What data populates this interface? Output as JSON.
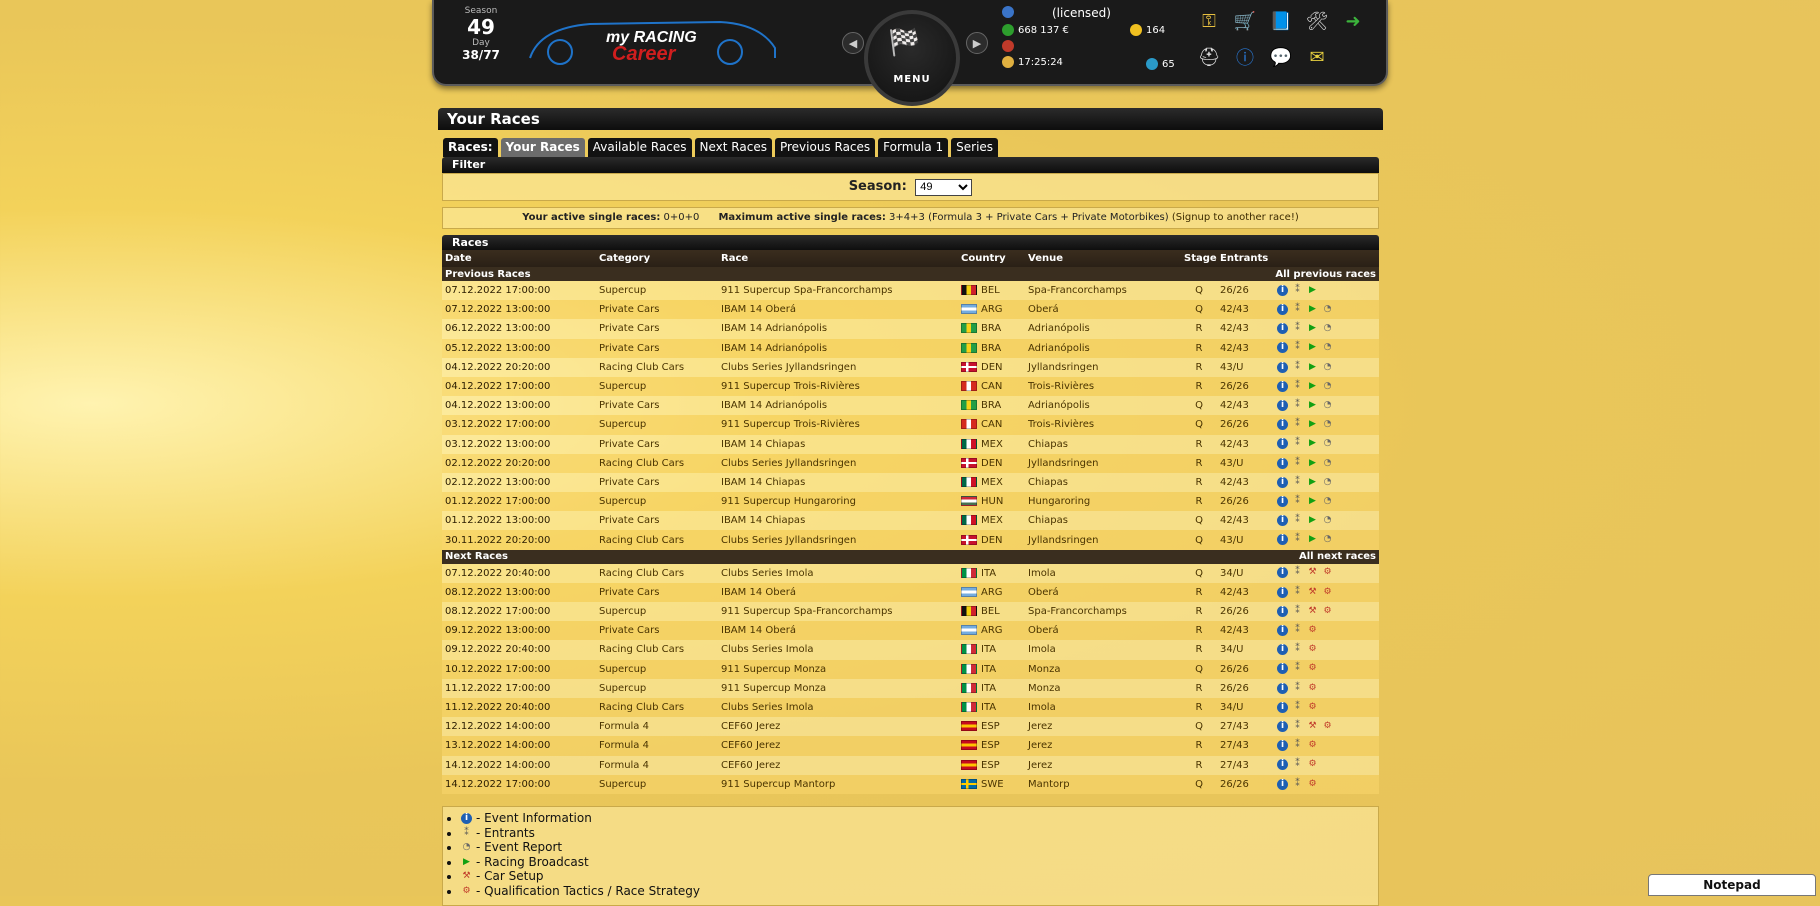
{
  "header": {
    "season_label": "Season",
    "season_value": "49",
    "day_label": "Day",
    "day_value": "38/77",
    "license": "(licensed)",
    "money": "668 137 €",
    "time": "17:25:24",
    "coins": "164",
    "points": "65",
    "menu_label": "MENU",
    "logo_text_top": "my RACING",
    "logo_text_bottom": "Career"
  },
  "page_title": "Your Races",
  "tabs": {
    "lead": "Races:",
    "items": [
      "Your Races",
      "Available Races",
      "Next Races",
      "Previous Races",
      "Formula 1",
      "Series"
    ]
  },
  "filter": {
    "title": "Filter",
    "season_label": "Season:",
    "season_value": "49"
  },
  "active_info": {
    "active_label": "Your active single races:",
    "active_value": "0+0+0",
    "max_label": "Maximum active single races:",
    "max_value": "3+4+3 (Formula 3 + Private Cars + Private Motorbikes)",
    "signup": "(Signup to another race!)"
  },
  "races": {
    "title": "Races",
    "columns": [
      "Date",
      "Category",
      "Race",
      "Country",
      "Venue",
      "Stage",
      "Entrants",
      ""
    ],
    "previous_label": "Previous Races",
    "previous_link": "All previous races",
    "next_label": "Next Races",
    "next_link": "All next races",
    "previous": [
      {
        "date": "07.12.2022 17:00:00",
        "category": "Supercup",
        "race": "911 Supercup Spa-Francorchamps",
        "country": "BEL",
        "venue": "Spa-Francorchamps",
        "stage": "Q",
        "entrants": "26/26"
      },
      {
        "date": "07.12.2022 13:00:00",
        "category": "Private Cars",
        "race": "IBAM 14 Oberá",
        "country": "ARG",
        "venue": "Oberá",
        "stage": "Q",
        "entrants": "42/43"
      },
      {
        "date": "06.12.2022 13:00:00",
        "category": "Private Cars",
        "race": "IBAM 14 Adrianópolis",
        "country": "BRA",
        "venue": "Adrianópolis",
        "stage": "R",
        "entrants": "42/43"
      },
      {
        "date": "05.12.2022 13:00:00",
        "category": "Private Cars",
        "race": "IBAM 14 Adrianópolis",
        "country": "BRA",
        "venue": "Adrianópolis",
        "stage": "R",
        "entrants": "42/43"
      },
      {
        "date": "04.12.2022 20:20:00",
        "category": "Racing Club Cars",
        "race": "Clubs Series Jyllandsringen",
        "country": "DEN",
        "venue": "Jyllandsringen",
        "stage": "R",
        "entrants": "43/U"
      },
      {
        "date": "04.12.2022 17:00:00",
        "category": "Supercup",
        "race": "911 Supercup Trois-Rivières",
        "country": "CAN",
        "venue": "Trois-Rivières",
        "stage": "R",
        "entrants": "26/26"
      },
      {
        "date": "04.12.2022 13:00:00",
        "category": "Private Cars",
        "race": "IBAM 14 Adrianópolis",
        "country": "BRA",
        "venue": "Adrianópolis",
        "stage": "Q",
        "entrants": "42/43"
      },
      {
        "date": "03.12.2022 17:00:00",
        "category": "Supercup",
        "race": "911 Supercup Trois-Rivières",
        "country": "CAN",
        "venue": "Trois-Rivières",
        "stage": "Q",
        "entrants": "26/26"
      },
      {
        "date": "03.12.2022 13:00:00",
        "category": "Private Cars",
        "race": "IBAM 14 Chiapas",
        "country": "MEX",
        "venue": "Chiapas",
        "stage": "R",
        "entrants": "42/43"
      },
      {
        "date": "02.12.2022 20:20:00",
        "category": "Racing Club Cars",
        "race": "Clubs Series Jyllandsringen",
        "country": "DEN",
        "venue": "Jyllandsringen",
        "stage": "R",
        "entrants": "43/U"
      },
      {
        "date": "02.12.2022 13:00:00",
        "category": "Private Cars",
        "race": "IBAM 14 Chiapas",
        "country": "MEX",
        "venue": "Chiapas",
        "stage": "R",
        "entrants": "42/43"
      },
      {
        "date": "01.12.2022 17:00:00",
        "category": "Supercup",
        "race": "911 Supercup Hungaroring",
        "country": "HUN",
        "venue": "Hungaroring",
        "stage": "R",
        "entrants": "26/26"
      },
      {
        "date": "01.12.2022 13:00:00",
        "category": "Private Cars",
        "race": "IBAM 14 Chiapas",
        "country": "MEX",
        "venue": "Chiapas",
        "stage": "Q",
        "entrants": "42/43"
      },
      {
        "date": "30.11.2022 20:20:00",
        "category": "Racing Club Cars",
        "race": "Clubs Series Jyllandsringen",
        "country": "DEN",
        "venue": "Jyllandsringen",
        "stage": "Q",
        "entrants": "43/U"
      }
    ],
    "next": [
      {
        "date": "07.12.2022 20:40:00",
        "category": "Racing Club Cars",
        "race": "Clubs Series Imola",
        "country": "ITA",
        "venue": "Imola",
        "stage": "Q",
        "entrants": "34/U",
        "setup": true
      },
      {
        "date": "08.12.2022 13:00:00",
        "category": "Private Cars",
        "race": "IBAM 14 Oberá",
        "country": "ARG",
        "venue": "Oberá",
        "stage": "R",
        "entrants": "42/43",
        "setup": true
      },
      {
        "date": "08.12.2022 17:00:00",
        "category": "Supercup",
        "race": "911 Supercup Spa-Francorchamps",
        "country": "BEL",
        "venue": "Spa-Francorchamps",
        "stage": "R",
        "entrants": "26/26",
        "setup": true
      },
      {
        "date": "09.12.2022 13:00:00",
        "category": "Private Cars",
        "race": "IBAM 14 Oberá",
        "country": "ARG",
        "venue": "Oberá",
        "stage": "R",
        "entrants": "42/43",
        "setup": false
      },
      {
        "date": "09.12.2022 20:40:00",
        "category": "Racing Club Cars",
        "race": "Clubs Series Imola",
        "country": "ITA",
        "venue": "Imola",
        "stage": "R",
        "entrants": "34/U",
        "setup": false
      },
      {
        "date": "10.12.2022 17:00:00",
        "category": "Supercup",
        "race": "911 Supercup Monza",
        "country": "ITA",
        "venue": "Monza",
        "stage": "Q",
        "entrants": "26/26",
        "setup": false
      },
      {
        "date": "11.12.2022 17:00:00",
        "category": "Supercup",
        "race": "911 Supercup Monza",
        "country": "ITA",
        "venue": "Monza",
        "stage": "R",
        "entrants": "26/26",
        "setup": false
      },
      {
        "date": "11.12.2022 20:40:00",
        "category": "Racing Club Cars",
        "race": "Clubs Series Imola",
        "country": "ITA",
        "venue": "Imola",
        "stage": "R",
        "entrants": "34/U",
        "setup": false
      },
      {
        "date": "12.12.2022 14:00:00",
        "category": "Formula 4",
        "race": "CEF60 Jerez",
        "country": "ESP",
        "venue": "Jerez",
        "stage": "Q",
        "entrants": "27/43",
        "setup": true
      },
      {
        "date": "13.12.2022 14:00:00",
        "category": "Formula 4",
        "race": "CEF60 Jerez",
        "country": "ESP",
        "venue": "Jerez",
        "stage": "R",
        "entrants": "27/43",
        "setup": false
      },
      {
        "date": "14.12.2022 14:00:00",
        "category": "Formula 4",
        "race": "CEF60 Jerez",
        "country": "ESP",
        "venue": "Jerez",
        "stage": "R",
        "entrants": "27/43",
        "setup": false
      },
      {
        "date": "14.12.2022 17:00:00",
        "category": "Supercup",
        "race": "911 Supercup Mantorp",
        "country": "SWE",
        "venue": "Mantorp",
        "stage": "Q",
        "entrants": "26/26",
        "setup": false
      }
    ]
  },
  "legend": [
    "- Event Information",
    "- Entrants",
    "- Event Report",
    "- Racing Broadcast",
    "- Car Setup",
    "- Qualification Tactics / Race Strategy"
  ],
  "notepad": "Notepad",
  "flag_colors": {
    "BEL": [
      "#111111",
      "#f5d10d",
      "#d0212b"
    ],
    "ARG": [
      "#74acdf",
      "#ffffff",
      "#74acdf"
    ],
    "BRA": [
      "#229e45",
      "#f8d117",
      "#229e45"
    ],
    "DEN": [
      "#c8102e",
      "#ffffff",
      "#c8102e"
    ],
    "CAN": [
      "#d52b1e",
      "#ffffff",
      "#d52b1e"
    ],
    "MEX": [
      "#006847",
      "#ffffff",
      "#ce1126"
    ],
    "HUN": [
      "#ce2939",
      "#ffffff",
      "#477050"
    ],
    "ITA": [
      "#009246",
      "#ffffff",
      "#ce2b37"
    ],
    "ESP": [
      "#c60b1e",
      "#ffc400",
      "#c60b1e"
    ],
    "SWE": [
      "#006aa7",
      "#fecc00",
      "#006aa7"
    ]
  }
}
